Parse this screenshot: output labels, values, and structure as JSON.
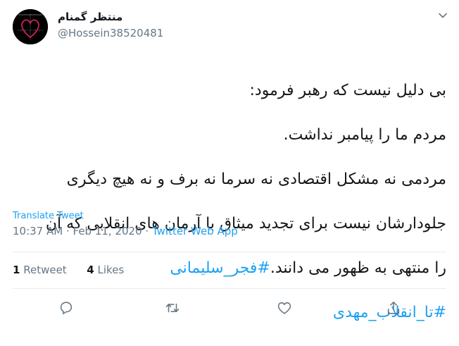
{
  "author": {
    "display_name": "منتظر گمنام",
    "handle": "@Hossein38520481",
    "avatar_icon": "heart-chart-avatar-icon"
  },
  "tweet": {
    "lines": [
      "بی دلیل نیست که رهبر فرمود:",
      "مردم ما را پیامبر نداشت.",
      "مردمی نه مشکل اقتصادی نه سرما نه برف و نه هیچ دیگری",
      "جلودارشان نیست برای تجدید میثاق با آرمان های انقلابی که آن"
    ],
    "line5_text": "را منتهی به ظهور می دانند.",
    "hashtag_1": "#فجر_سلیمانی",
    "hashtag_2": "#تا_انقلاب_مهدی"
  },
  "translate_label": "Translate Tweet",
  "meta": {
    "time": "10:37 AM",
    "separator": " · ",
    "date": "Feb 11, 2020",
    "source": "Twitter Web App"
  },
  "stats": {
    "retweets_count": "1",
    "retweets_label": "Retweet",
    "likes_count": "4",
    "likes_label": "Likes"
  },
  "actions": [
    "reply-icon",
    "retweet-icon",
    "like-icon",
    "share-icon"
  ],
  "colors": {
    "link": "#1da1f2",
    "muted": "#657786",
    "text": "#14171a",
    "divider": "#e6ecf0"
  }
}
